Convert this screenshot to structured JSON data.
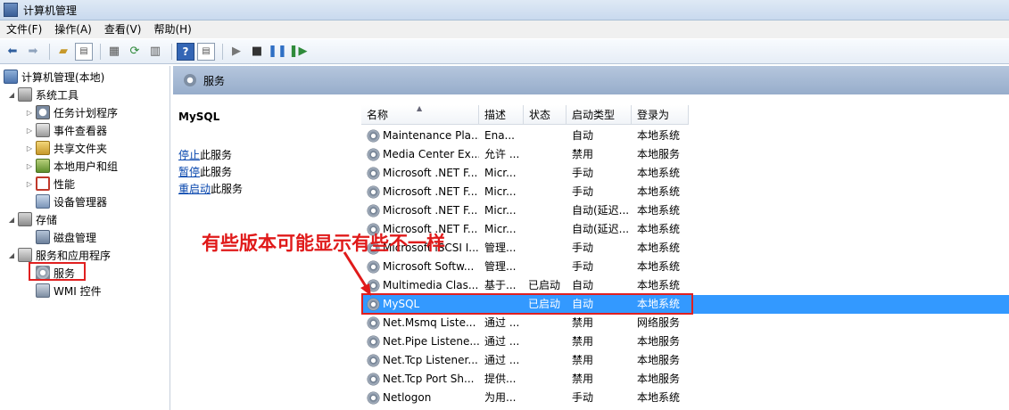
{
  "window": {
    "title": "计算机管理"
  },
  "menu": [
    {
      "label": "文件(F)"
    },
    {
      "label": "操作(A)"
    },
    {
      "label": "查看(V)"
    },
    {
      "label": "帮助(H)"
    }
  ],
  "toolbar": {
    "help_label": "?"
  },
  "tree": {
    "root": "计算机管理(本地)",
    "system_tools": "系统工具",
    "task_scheduler": "任务计划程序",
    "event_viewer": "事件查看器",
    "shared_folders": "共享文件夹",
    "local_users": "本地用户和组",
    "performance": "性能",
    "device_manager": "设备管理器",
    "storage": "存储",
    "disk_management": "磁盘管理",
    "services_apps": "服务和应用程序",
    "services": "服务",
    "wmi": "WMI 控件"
  },
  "panel": {
    "title": "服务"
  },
  "description": {
    "service_name": "MySQL",
    "stop_link": "停止",
    "stop_suffix": "此服务",
    "pause_link": "暂停",
    "pause_suffix": "此服务",
    "restart_link": "重启动",
    "restart_suffix": "此服务"
  },
  "columns": {
    "name": "名称",
    "description": "描述",
    "status": "状态",
    "startup_type": "启动类型",
    "logon_as": "登录为"
  },
  "services": [
    {
      "name": "Maintenance Pla...",
      "desc": "Ena...",
      "status": "",
      "startup": "自动",
      "logon": "本地系统"
    },
    {
      "name": "Media Center Ex...",
      "desc": "允许 ...",
      "status": "",
      "startup": "禁用",
      "logon": "本地服务"
    },
    {
      "name": "Microsoft .NET F...",
      "desc": "Micr...",
      "status": "",
      "startup": "手动",
      "logon": "本地系统"
    },
    {
      "name": "Microsoft .NET F...",
      "desc": "Micr...",
      "status": "",
      "startup": "手动",
      "logon": "本地系统"
    },
    {
      "name": "Microsoft .NET F...",
      "desc": "Micr...",
      "status": "",
      "startup": "自动(延迟...",
      "logon": "本地系统"
    },
    {
      "name": "Microsoft .NET F...",
      "desc": "Micr...",
      "status": "",
      "startup": "自动(延迟...",
      "logon": "本地系统"
    },
    {
      "name": "Microsoft iSCSI I...",
      "desc": "管理...",
      "status": "",
      "startup": "手动",
      "logon": "本地系统"
    },
    {
      "name": "Microsoft Softw...",
      "desc": "管理...",
      "status": "",
      "startup": "手动",
      "logon": "本地系统"
    },
    {
      "name": "Multimedia Clas...",
      "desc": "基于...",
      "status": "已启动",
      "startup": "自动",
      "logon": "本地系统"
    },
    {
      "name": "MySQL",
      "desc": "",
      "status": "已启动",
      "startup": "自动",
      "logon": "本地系统",
      "selected": true
    },
    {
      "name": "Net.Msmq Liste...",
      "desc": "通过 ...",
      "status": "",
      "startup": "禁用",
      "logon": "网络服务"
    },
    {
      "name": "Net.Pipe Listene...",
      "desc": "通过 ...",
      "status": "",
      "startup": "禁用",
      "logon": "本地服务"
    },
    {
      "name": "Net.Tcp Listener...",
      "desc": "通过 ...",
      "status": "",
      "startup": "禁用",
      "logon": "本地服务"
    },
    {
      "name": "Net.Tcp Port Sh...",
      "desc": "提供...",
      "status": "",
      "startup": "禁用",
      "logon": "本地服务"
    },
    {
      "name": "Netlogon",
      "desc": "为用...",
      "status": "",
      "startup": "手动",
      "logon": "本地系统"
    }
  ],
  "annotation": {
    "text": "有些版本可能显示有些不一样",
    "color": "#e01a1a"
  },
  "colors": {
    "selection": "#3399ff",
    "highlight_box": "#e02020",
    "header_band": "#a6bad6"
  }
}
